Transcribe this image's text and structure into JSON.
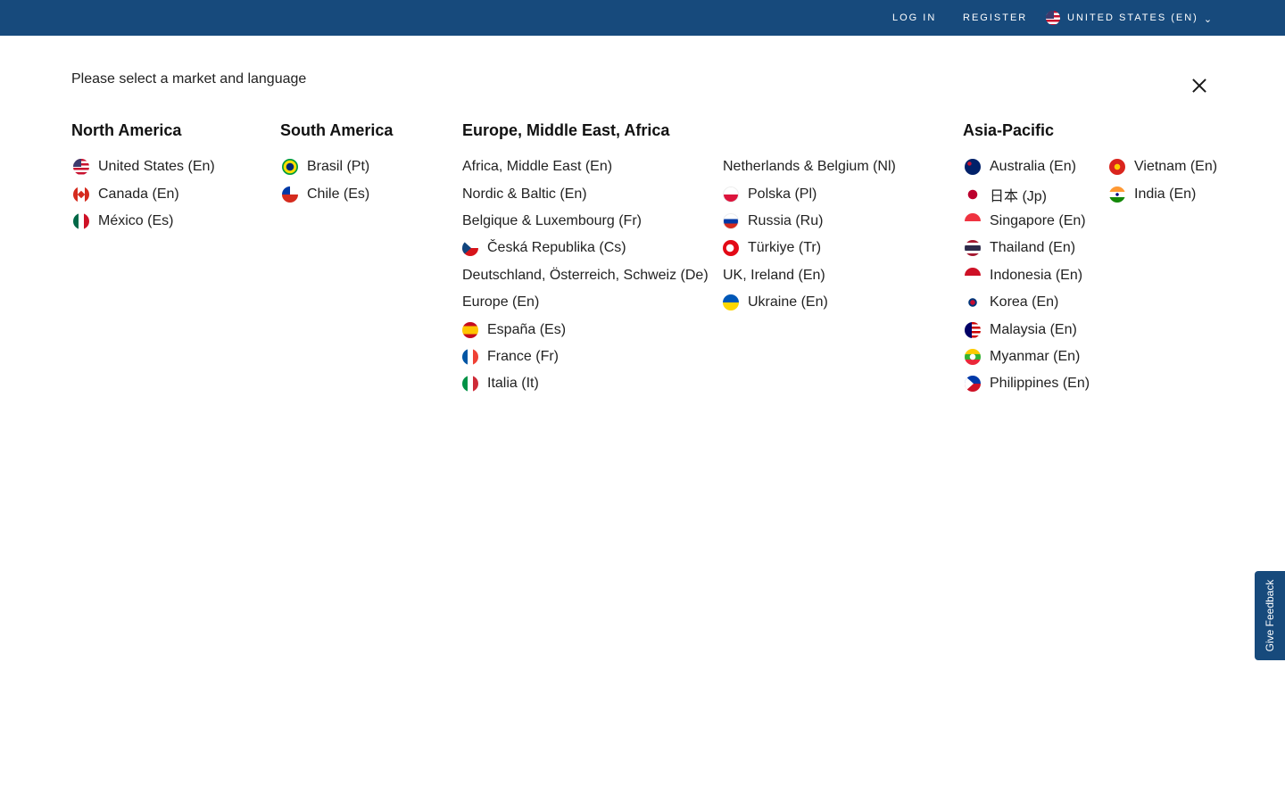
{
  "header": {
    "login": "LOG IN",
    "register": "REGISTER",
    "market": "UNITED STATES (EN)",
    "market_flag_icon": "us-flag-icon",
    "chevron_icon": "chevron-down-icon",
    "background_color": "#174a7c"
  },
  "modal": {
    "prompt": "Please select a market and language",
    "close_icon": "close-icon"
  },
  "regions": {
    "north_america": {
      "title": "North America",
      "items": [
        {
          "label": "United States (En)",
          "flag": "us"
        },
        {
          "label": "Canada (En)",
          "flag": "ca"
        },
        {
          "label": "México (Es)",
          "flag": "mx"
        }
      ]
    },
    "south_america": {
      "title": "South America",
      "items": [
        {
          "label": "Brasil (Pt)",
          "flag": "br"
        },
        {
          "label": "Chile (Es)",
          "flag": "cl"
        }
      ]
    },
    "emea": {
      "title": "Europe, Middle East, Africa",
      "col1": [
        {
          "label": "Africa, Middle East (En)",
          "flag": ""
        },
        {
          "label": "Nordic & Baltic (En)",
          "flag": ""
        },
        {
          "label": "Belgique & Luxembourg (Fr)",
          "flag": ""
        },
        {
          "label": "Česká Republika (Cs)",
          "flag": "cz"
        },
        {
          "label": "Deutschland, Österreich, Schweiz (De)",
          "flag": ""
        },
        {
          "label": "Europe (En)",
          "flag": ""
        },
        {
          "label": "España (Es)",
          "flag": "es"
        },
        {
          "label": "France (Fr)",
          "flag": "fr"
        },
        {
          "label": "Italia (It)",
          "flag": "it"
        }
      ],
      "col2": [
        {
          "label": "Netherlands & Belgium (Nl)",
          "flag": ""
        },
        {
          "label": "Polska (Pl)",
          "flag": "pl"
        },
        {
          "label": "Russia (Ru)",
          "flag": "ru"
        },
        {
          "label": "Türkiye (Tr)",
          "flag": "tr"
        },
        {
          "label": "UK, Ireland (En)",
          "flag": ""
        },
        {
          "label": "Ukraine (En)",
          "flag": "ua"
        }
      ]
    },
    "apac": {
      "title": "Asia-Pacific",
      "col1": [
        {
          "label": "Australia (En)",
          "flag": "au"
        },
        {
          "label": "日本 (Jp)",
          "flag": "jp"
        },
        {
          "label": "Singapore (En)",
          "flag": "sg"
        },
        {
          "label": "Thailand (En)",
          "flag": "th"
        },
        {
          "label": "Indonesia (En)",
          "flag": "id"
        },
        {
          "label": "Korea (En)",
          "flag": "kr"
        },
        {
          "label": "Malaysia (En)",
          "flag": "my"
        },
        {
          "label": "Myanmar (En)",
          "flag": "mm"
        },
        {
          "label": "Philippines (En)",
          "flag": "ph"
        }
      ],
      "col2": [
        {
          "label": "Vietnam (En)",
          "flag": "vn"
        },
        {
          "label": "India (En)",
          "flag": "in"
        }
      ]
    }
  },
  "feedback": {
    "label": "Give Feedback"
  }
}
